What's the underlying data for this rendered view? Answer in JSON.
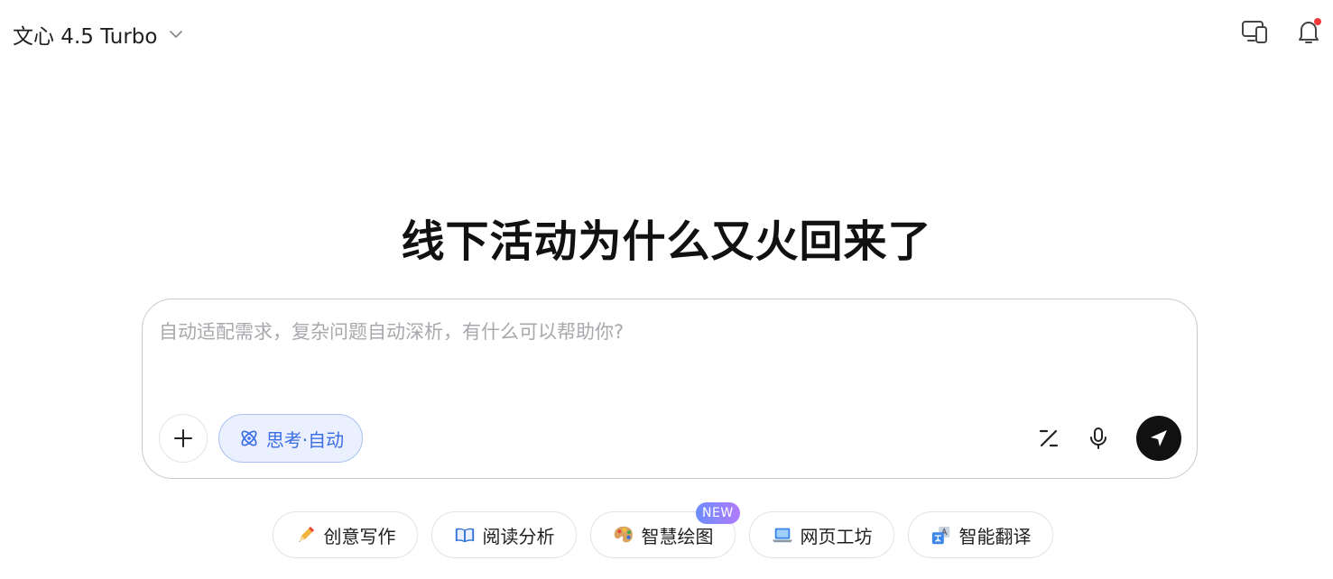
{
  "header": {
    "model_name": "文心 4.5 Turbo",
    "icons": [
      "devices-icon",
      "bell-icon"
    ]
  },
  "hero": {
    "title": "线下活动为什么又火回来了"
  },
  "composer": {
    "placeholder": "自动适配需求，复杂问题自动深析，有什么可以帮助你?",
    "value": "",
    "think_mode_label": "思考·自动"
  },
  "quick_actions": [
    {
      "label": "创意写作",
      "icon": "pencil-icon"
    },
    {
      "label": "阅读分析",
      "icon": "book-icon"
    },
    {
      "label": "智慧绘图",
      "icon": "palette-icon",
      "badge": "NEW"
    },
    {
      "label": "网页工坊",
      "icon": "laptop-icon"
    },
    {
      "label": "智能翻译",
      "icon": "translate-icon"
    }
  ],
  "colors": {
    "accent": "#3b6ee6",
    "accent_bg": "#eaf0fd",
    "notification_dot": "#f0393a",
    "send_button": "#111111"
  }
}
